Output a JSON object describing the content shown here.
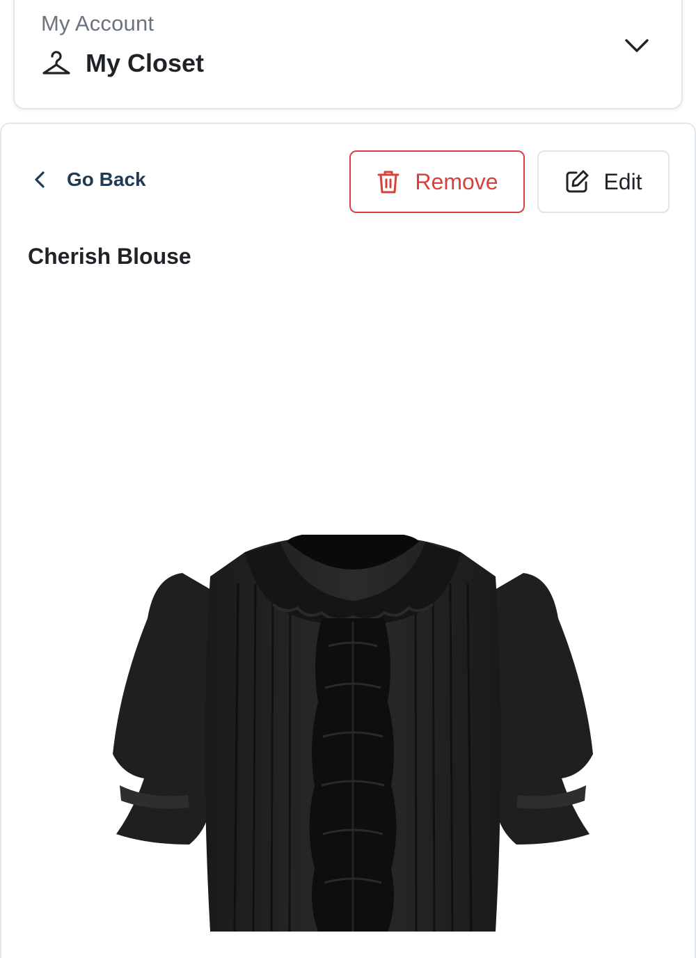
{
  "account_selector": {
    "label": "My Account",
    "current_section": "My Closet",
    "current_icon": "hanger-icon",
    "toggle_icon": "chevron-down-icon"
  },
  "detail": {
    "back_label": "Go Back",
    "back_icon": "chevron-left-icon",
    "remove_label": "Remove",
    "remove_icon": "trash-icon",
    "edit_label": "Edit",
    "edit_icon": "edit-icon",
    "item_title": "Cherish Blouse",
    "product_image_alt": "Cherish Blouse"
  },
  "colors": {
    "danger": "#d8403d",
    "link": "#1f3a52",
    "text": "#1f2328",
    "muted": "#6b7280",
    "border": "#e3e7ec"
  }
}
